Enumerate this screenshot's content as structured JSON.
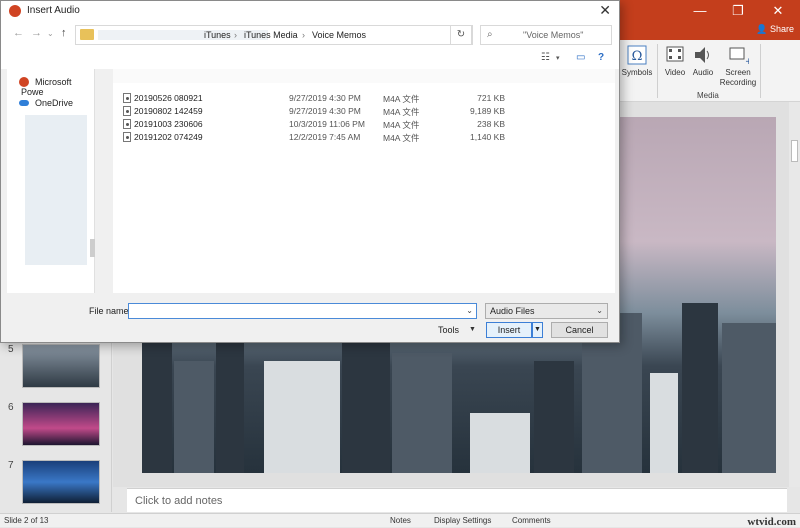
{
  "dialog": {
    "title": "Insert Audio",
    "close": "✕",
    "breadcrumb": [
      "iTunes",
      "iTunes Media",
      "Voice Memos"
    ],
    "breadcrumb_sep": "›",
    "search_placeholder": "\"Voice Memos\"",
    "nav_items": [
      {
        "label": "Microsoft Powe",
        "icon": "powerpoint-icon"
      },
      {
        "label": "OneDrive",
        "icon": "onedrive-icon"
      }
    ],
    "files": [
      {
        "name": "20190526 080921",
        "date": "9/27/2019 4:30 PM",
        "type": "M4A 文件",
        "size": "721 KB"
      },
      {
        "name": "20190802 142459",
        "date": "9/27/2019 4:30 PM",
        "type": "M4A 文件",
        "size": "9,189 KB"
      },
      {
        "name": "20191003 230606",
        "date": "10/3/2019 11:06 PM",
        "type": "M4A 文件",
        "size": "238 KB"
      },
      {
        "name": "20191202 074249",
        "date": "12/2/2019 7:45 AM",
        "type": "M4A 文件",
        "size": "1,140 KB"
      }
    ],
    "file_name_label": "File name:",
    "file_name_value": "",
    "file_type": "Audio Files",
    "tools_label": "Tools",
    "insert_label": "Insert",
    "cancel_label": "Cancel"
  },
  "ppt": {
    "share_label": "Share",
    "ribbon": [
      {
        "label": "Symbols",
        "icon": "omega-icon"
      },
      {
        "label": "Video",
        "icon": "video-icon"
      },
      {
        "label": "Audio",
        "icon": "audio-icon"
      },
      {
        "label": "Screen\nRecording",
        "icon": "screen-recording-icon"
      }
    ],
    "media_group": "Media",
    "thumb_numbers": [
      "5",
      "6",
      "7"
    ],
    "notes_placeholder": "Click to add notes",
    "status": {
      "slide": "Slide 2 of 13",
      "notes": "Notes",
      "display": "Display Settings",
      "comments": "Comments"
    },
    "watermark": "wtvid.com"
  },
  "colors": {
    "ppt_brand": "#c43e1c",
    "accent": "#3c7fd6"
  }
}
